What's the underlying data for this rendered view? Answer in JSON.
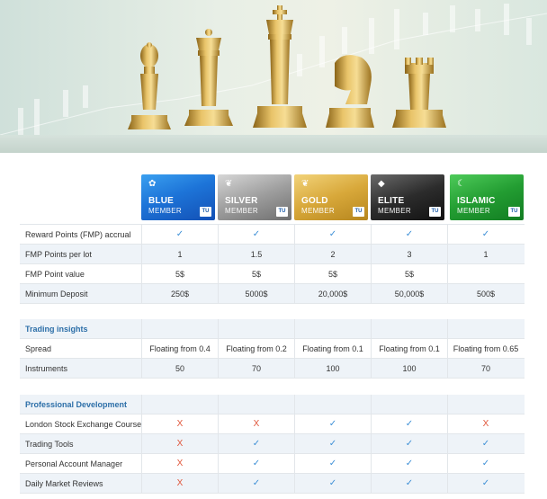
{
  "hero": {
    "image": "gold-chess-pieces-on-trading-chart"
  },
  "tiers": [
    {
      "name": "BLUE",
      "sub": "MEMBER",
      "emblem": "ribbon-icon",
      "color": "#1d74d8"
    },
    {
      "name": "SILVER",
      "sub": "MEMBER",
      "emblem": "wings-icon",
      "color": "#9e9e9e"
    },
    {
      "name": "GOLD",
      "sub": "MEMBER",
      "emblem": "wings-icon",
      "color": "#d8a83a"
    },
    {
      "name": "ELITE",
      "sub": "MEMBER",
      "emblem": "diamond-icon",
      "color": "#2c2c2c"
    },
    {
      "name": "ISLAMIC",
      "sub": "MEMBER",
      "emblem": "crescent-icon",
      "color": "#239d32"
    }
  ],
  "tag": "TU",
  "rows": {
    "reward": {
      "label": "Reward Points (FMP) accrual",
      "values": [
        "✓",
        "✓",
        "✓",
        "✓",
        "✓"
      ]
    },
    "fmp_lot": {
      "label": "FMP Points per lot",
      "values": [
        "1",
        "1.5",
        "2",
        "3",
        "1"
      ]
    },
    "fmp_value": {
      "label": "FMP Point value",
      "values": [
        "5$",
        "5$",
        "5$",
        "5$",
        ""
      ]
    },
    "min_dep": {
      "label": "Minimum Deposit",
      "values": [
        "250$",
        "5000$",
        "20,000$",
        "50,000$",
        "500$"
      ]
    },
    "sec1": {
      "label": "Trading insights"
    },
    "spread": {
      "label": "Spread",
      "values": [
        "Floating from 0.4",
        "Floating from 0.2",
        "Floating from 0.1",
        "Floating from 0.1",
        "Floating from 0.65"
      ]
    },
    "instr": {
      "label": "Instruments",
      "values": [
        "50",
        "70",
        "100",
        "100",
        "70"
      ]
    },
    "sec2": {
      "label": "Professional Development"
    },
    "lse": {
      "label": "London Stock Exchange Course",
      "values": [
        "X",
        "X",
        "✓",
        "✓",
        "X"
      ]
    },
    "tools": {
      "label": "Trading Tools",
      "values": [
        "X",
        "✓",
        "✓",
        "✓",
        "✓"
      ]
    },
    "pam": {
      "label": "Personal Account Manager",
      "values": [
        "X",
        "✓",
        "✓",
        "✓",
        "✓"
      ]
    },
    "dmr": {
      "label": "Daily Market Reviews",
      "values": [
        "X",
        "✓",
        "✓",
        "✓",
        "✓"
      ]
    }
  }
}
